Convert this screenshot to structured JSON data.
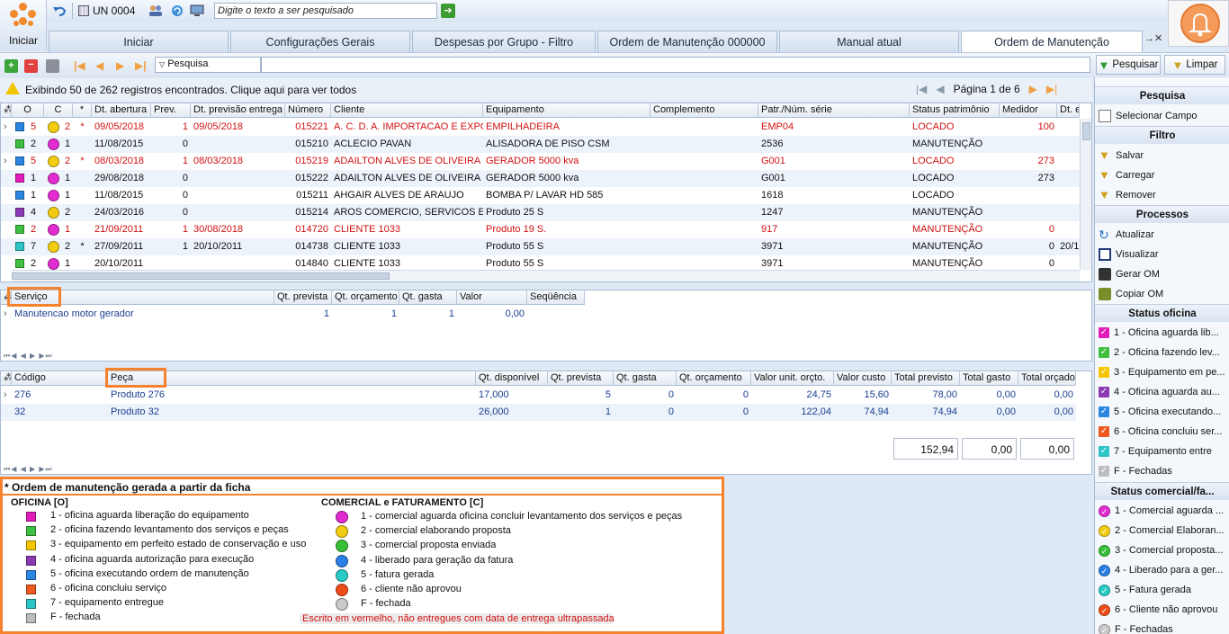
{
  "app": {
    "start_label": "Iniciar",
    "unit": "UN 0004",
    "search_placeholder": "Digite o texto a ser pesquisado"
  },
  "tabs": [
    "Iniciar",
    "Configurações Gerais",
    "Despesas por Grupo - Filtro",
    "Ordem de Manutenção 000000",
    "Manual atual",
    "Ordem de Manutenção"
  ],
  "toolbar": {
    "filter_label": "Pesquisa",
    "search_btn": "Pesquisar",
    "clear_btn": "Limpar"
  },
  "info": {
    "message": "Exibindo 50 de 262 registros encontrados. Clique aqui para ver todos",
    "page": "Página 1 de 6"
  },
  "colors": {
    "o1": "#e21cb8",
    "o2": "#3fbf3f",
    "o3": "#f3c600",
    "o4": "#8b39b5",
    "o5": "#2a86e0",
    "o6": "#ee5a1d",
    "o7": "#2cc4c4",
    "of": "#bdbdbd",
    "c1": "#e22bd0",
    "c2": "#f2cc10",
    "c3": "#38c038",
    "c4": "#2a7fe6",
    "c5": "#28cbc6",
    "c6": "#ef4d18",
    "cf": "#c9c9c9"
  },
  "main_grid": {
    "columns": [
      "O",
      "C",
      "*",
      "Dt. abertura",
      "Prev.",
      "Dt. previsão entrega",
      "Número",
      "Cliente",
      "Equipamento",
      "Complemento",
      "Patr./Núm. série",
      "Status patrimônio",
      "Medidor",
      "Dt. e"
    ],
    "rows": [
      {
        "o": "o5",
        "o_num": "5",
        "c": "c2",
        "c_num": "2",
        "star": "*",
        "dt": "09/05/2018",
        "prev": "1",
        "dtprev": "09/05/2018",
        "num": "015221",
        "cliente": "A. C. D. A. IMPORTACAO E EXPOR",
        "equip": "EMPILHADEIRA",
        "patr": "EMP04",
        "status": "LOCADO",
        "med": "100",
        "dte": "",
        "red": true
      },
      {
        "o": "o2",
        "o_num": "2",
        "c": "c1",
        "c_num": "1",
        "star": "",
        "dt": "11/08/2015",
        "prev": "0",
        "dtprev": "",
        "num": "015210",
        "cliente": "ACLECIO PAVAN",
        "equip": "ALISADORA DE PISO CSM",
        "patr": "2536",
        "status": "MANUTENÇÃO",
        "med": "",
        "dte": "",
        "red": false
      },
      {
        "o": "o5",
        "o_num": "5",
        "c": "c2",
        "c_num": "2",
        "star": "*",
        "dt": "08/03/2018",
        "prev": "1",
        "dtprev": "08/03/2018",
        "num": "015219",
        "cliente": "ADAILTON ALVES DE OLIVEIRA",
        "equip": "GERADOR 5000 kva",
        "patr": "G001",
        "status": "LOCADO",
        "med": "273",
        "dte": "",
        "red": true
      },
      {
        "o": "o1",
        "o_num": "1",
        "c": "c1",
        "c_num": "1",
        "star": "",
        "dt": "29/08/2018",
        "prev": "0",
        "dtprev": "",
        "num": "015222",
        "cliente": "ADAILTON ALVES DE OLIVEIRA",
        "equip": "GERADOR 5000 kva",
        "patr": "G001",
        "status": "LOCADO",
        "med": "273",
        "dte": "",
        "red": false
      },
      {
        "o": "o5",
        "o_num": "1",
        "c": "c1",
        "c_num": "1",
        "star": "",
        "dt": "11/08/2015",
        "prev": "0",
        "dtprev": "",
        "num": "015211",
        "cliente": "AHGAIR ALVES DE ARAUJO",
        "equip": "BOMBA P/ LAVAR HD 585",
        "patr": "1618",
        "status": "LOCADO",
        "med": "",
        "dte": "",
        "red": false
      },
      {
        "o": "o4",
        "o_num": "4",
        "c": "c2",
        "c_num": "2",
        "star": "",
        "dt": "24/03/2016",
        "prev": "0",
        "dtprev": "",
        "num": "015214",
        "cliente": "AROS COMERCIO, SERVICOS E MA",
        "equip": "Produto 25 S",
        "patr": "1247",
        "status": "MANUTENÇÃO",
        "med": "",
        "dte": "",
        "red": false
      },
      {
        "o": "o2",
        "o_num": "2",
        "c": "c1",
        "c_num": "1",
        "star": "",
        "dt": "21/09/2011",
        "prev": "1",
        "dtprev": "30/08/2018",
        "num": "014720",
        "cliente": "CLIENTE  1033",
        "equip": "Produto 19 S.",
        "patr": "917",
        "status": "MANUTENÇÃO",
        "med": "0",
        "dte": "",
        "red": true
      },
      {
        "o": "o7",
        "o_num": "7",
        "c": "c2",
        "c_num": "2",
        "star": "*",
        "dt": "27/09/2011",
        "prev": "1",
        "dtprev": "20/10/2011",
        "num": "014738",
        "cliente": "CLIENTE  1033",
        "equip": "Produto 55 S",
        "patr": "3971",
        "status": "MANUTENÇÃO",
        "med": "0",
        "dte": "20/1",
        "red": false
      },
      {
        "o": "o2",
        "o_num": "2",
        "c": "c1",
        "c_num": "1",
        "star": "",
        "dt": "20/10/2011",
        "prev": "",
        "dtprev": "",
        "num": "014840",
        "cliente": "CLIENTE  1033",
        "equip": "Produto 55 S",
        "patr": "3971",
        "status": "MANUTENÇÃO",
        "med": "0",
        "dte": "",
        "red": false
      }
    ]
  },
  "service_grid": {
    "columns": [
      "Serviço",
      "Qt. prevista",
      "Qt. orçamento",
      "Qt. gasta",
      "Valor",
      "Seqüência"
    ],
    "rows": [
      {
        "servico": "Manutencao motor gerador",
        "prev": "1",
        "orc": "1",
        "gasta": "1",
        "valor": "0,00",
        "seq": ""
      }
    ]
  },
  "parts_grid": {
    "columns": [
      "Código",
      "Peça",
      "Qt. disponível",
      "Qt. prevista",
      "Qt. gasta",
      "Qt. orçamento",
      "Valor unit. orçto.",
      "Valor custo",
      "Total previsto",
      "Total gasto",
      "Total orçado"
    ],
    "rows": [
      {
        "cod": "276",
        "peca": "Produto 276",
        "disp": "17,000",
        "prev": "5",
        "gasta": "0",
        "orc": "0",
        "vu": "24,75",
        "vc": "15,60",
        "tp": "78,00",
        "tg": "0,00",
        "to": "0,00"
      },
      {
        "cod": "32",
        "peca": "Produto 32",
        "disp": "26,000",
        "prev": "1",
        "gasta": "0",
        "orc": "0",
        "vu": "122,04",
        "vc": "74,94",
        "tp": "74,94",
        "tg": "0,00",
        "to": "0,00"
      }
    ],
    "totals": {
      "previsto": "152,94",
      "gasto": "0,00",
      "orcado": "0,00"
    }
  },
  "legend": {
    "note": "* Ordem de manutenção gerada a partir da ficha",
    "oficina_title": "OFICINA [O]",
    "comercial_title": "COMERCIAL e FATURAMENTO [C]",
    "oficina": [
      {
        "color": "o1",
        "label": "1 - oficina aguarda liberação do equipamento"
      },
      {
        "color": "o2",
        "label": "2 - oficina fazendo levantamento dos serviços e peças"
      },
      {
        "color": "o3",
        "label": "3 - equipamento em perfeito estado de conservação e uso"
      },
      {
        "color": "o4",
        "label": "4 - oficina aguarda autorização para execução"
      },
      {
        "color": "o5",
        "label": "5 - oficina executando ordem de manutenção"
      },
      {
        "color": "o6",
        "label": "6 - oficina concluiu serviço"
      },
      {
        "color": "o7",
        "label": "7 - equipamento entregue"
      },
      {
        "color": "of",
        "label": "F - fechada"
      }
    ],
    "comercial": [
      {
        "color": "c1",
        "label": "1 - comercial aguarda oficina concluir levantamento dos serviços e peças"
      },
      {
        "color": "c2",
        "label": "2 - comercial elaborando proposta"
      },
      {
        "color": "c3",
        "label": "3 - comercial proposta enviada"
      },
      {
        "color": "c4",
        "label": "4 - liberado para geração da fatura"
      },
      {
        "color": "c5",
        "label": "5 - fatura gerada"
      },
      {
        "color": "c6",
        "label": "6 - cliente não aprovou"
      },
      {
        "color": "cf",
        "label": "F - fechada"
      }
    ],
    "red_note": "Escrito em vermelho, não entregues com data de entrega ultrapassada"
  },
  "right_panel": {
    "pesquisa_title": "Pesquisa",
    "selecionar": "Selecionar Campo",
    "filtro_title": "Filtro",
    "salvar": "Salvar",
    "carregar": "Carregar",
    "remover": "Remover",
    "processos_title": "Processos",
    "atualizar": "Atualizar",
    "visualizar": "Visualizar",
    "gerar": "Gerar OM",
    "copiar": "Copiar OM",
    "oficina_title": "Status oficina",
    "oficina": [
      {
        "color": "o1",
        "label": "1 - Oficina aguarda lib..."
      },
      {
        "color": "o2",
        "label": "2 - Oficina fazendo lev..."
      },
      {
        "color": "o3",
        "label": "3 - Equipamento em pe..."
      },
      {
        "color": "o4",
        "label": "4 - Oficina aguarda au..."
      },
      {
        "color": "o5",
        "label": "5 - Oficina executando..."
      },
      {
        "color": "o6",
        "label": "6 - Oficina concluiu ser..."
      },
      {
        "color": "o7",
        "label": "7 - Equipamento entre"
      },
      {
        "color": "of",
        "label": "F - Fechadas"
      }
    ],
    "comercial_title": "Status comercial/fa...",
    "comercial": [
      {
        "color": "c1",
        "label": "1 - Comercial aguarda ..."
      },
      {
        "color": "c2",
        "label": "2 - Comercial Elaboran..."
      },
      {
        "color": "c3",
        "label": "3 - Comercial proposta..."
      },
      {
        "color": "c4",
        "label": "4 - Liberado para a ger..."
      },
      {
        "color": "c5",
        "label": "5 - Fatura gerada"
      },
      {
        "color": "c6",
        "label": "6 - Cliente não aprovou"
      },
      {
        "color": "cf",
        "label": "F - Fechadas"
      }
    ]
  }
}
